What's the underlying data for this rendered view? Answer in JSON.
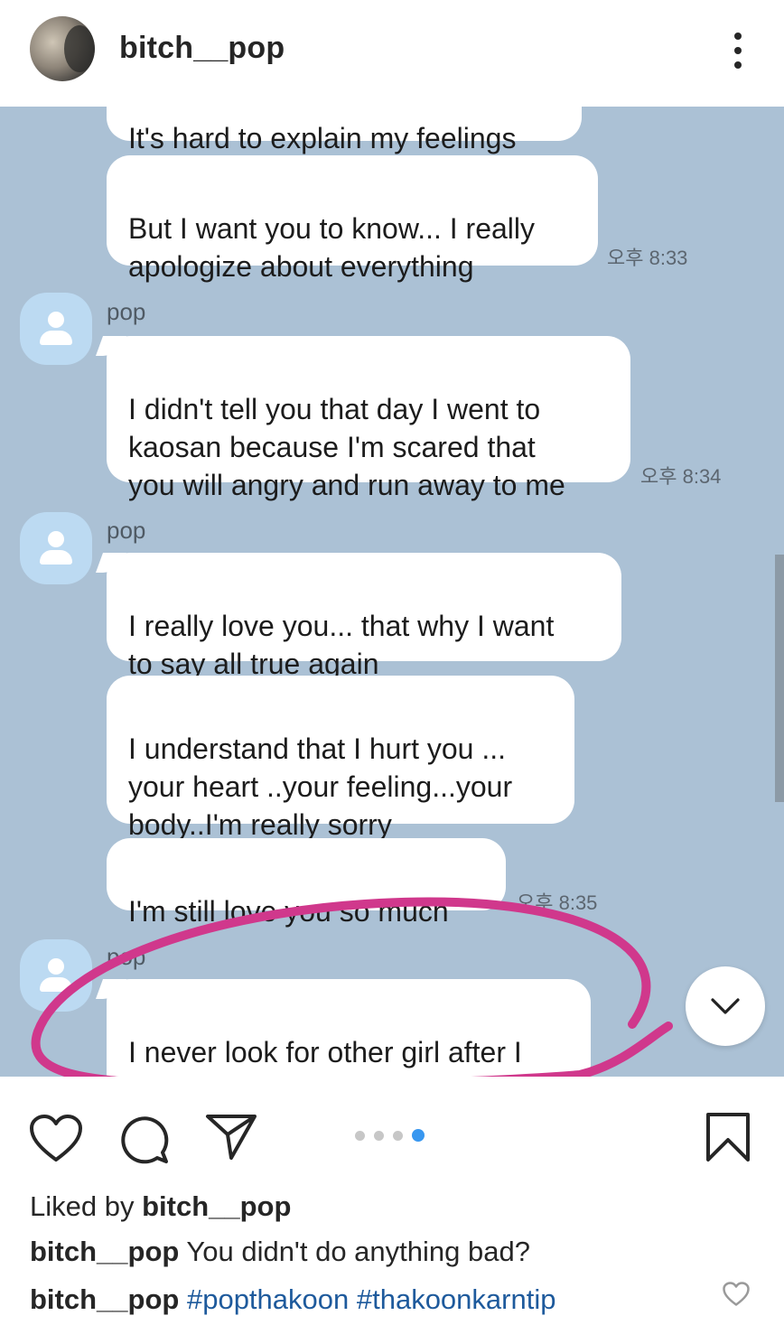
{
  "header": {
    "username": "bitch__pop",
    "more_icon": "more-vertical-icon"
  },
  "chat": {
    "partial_top_message": "It's hard to explain my feelings",
    "messages": [
      {
        "sender": "",
        "text": "But I want you to know... I really\napologize about everything",
        "time": "오후 8:33"
      },
      {
        "sender": "pop",
        "text": "I didn't tell you that day I went to\nkaosan because I'm scared that\nyou will angry and run away to me",
        "time": "오후 8:34"
      },
      {
        "sender": "pop",
        "text": "I really love you... that why I want\nto say all true again",
        "time": ""
      },
      {
        "sender": "",
        "text": "I understand that I hurt you ...\nyour heart ..your feeling...your\nbody..I'm really sorry",
        "time": ""
      },
      {
        "sender": "",
        "text": "I'm still love you so much",
        "time": "오후 8:35"
      },
      {
        "sender": "pop",
        "text": "I never look for other girl after I\nmet you",
        "time": ""
      }
    ],
    "annotation_color": "#d0388c"
  },
  "actions": {
    "like_icon": "heart-icon",
    "comment_icon": "comment-icon",
    "share_icon": "send-icon",
    "save_icon": "bookmark-icon",
    "carousel_total": 4,
    "carousel_active": 4
  },
  "caption": {
    "liked_prefix": "Liked by ",
    "liked_user": "bitch__pop",
    "comment_user": "bitch__pop",
    "comment_text": " You didn't do anything bad?",
    "tags_user": "bitch__pop",
    "tags": "#popthakoon #thakoonkarntip"
  },
  "colors": {
    "chat_background": "#abc1d5",
    "hashtag": "#1e5a9c",
    "carousel_active": "#3897f0"
  }
}
